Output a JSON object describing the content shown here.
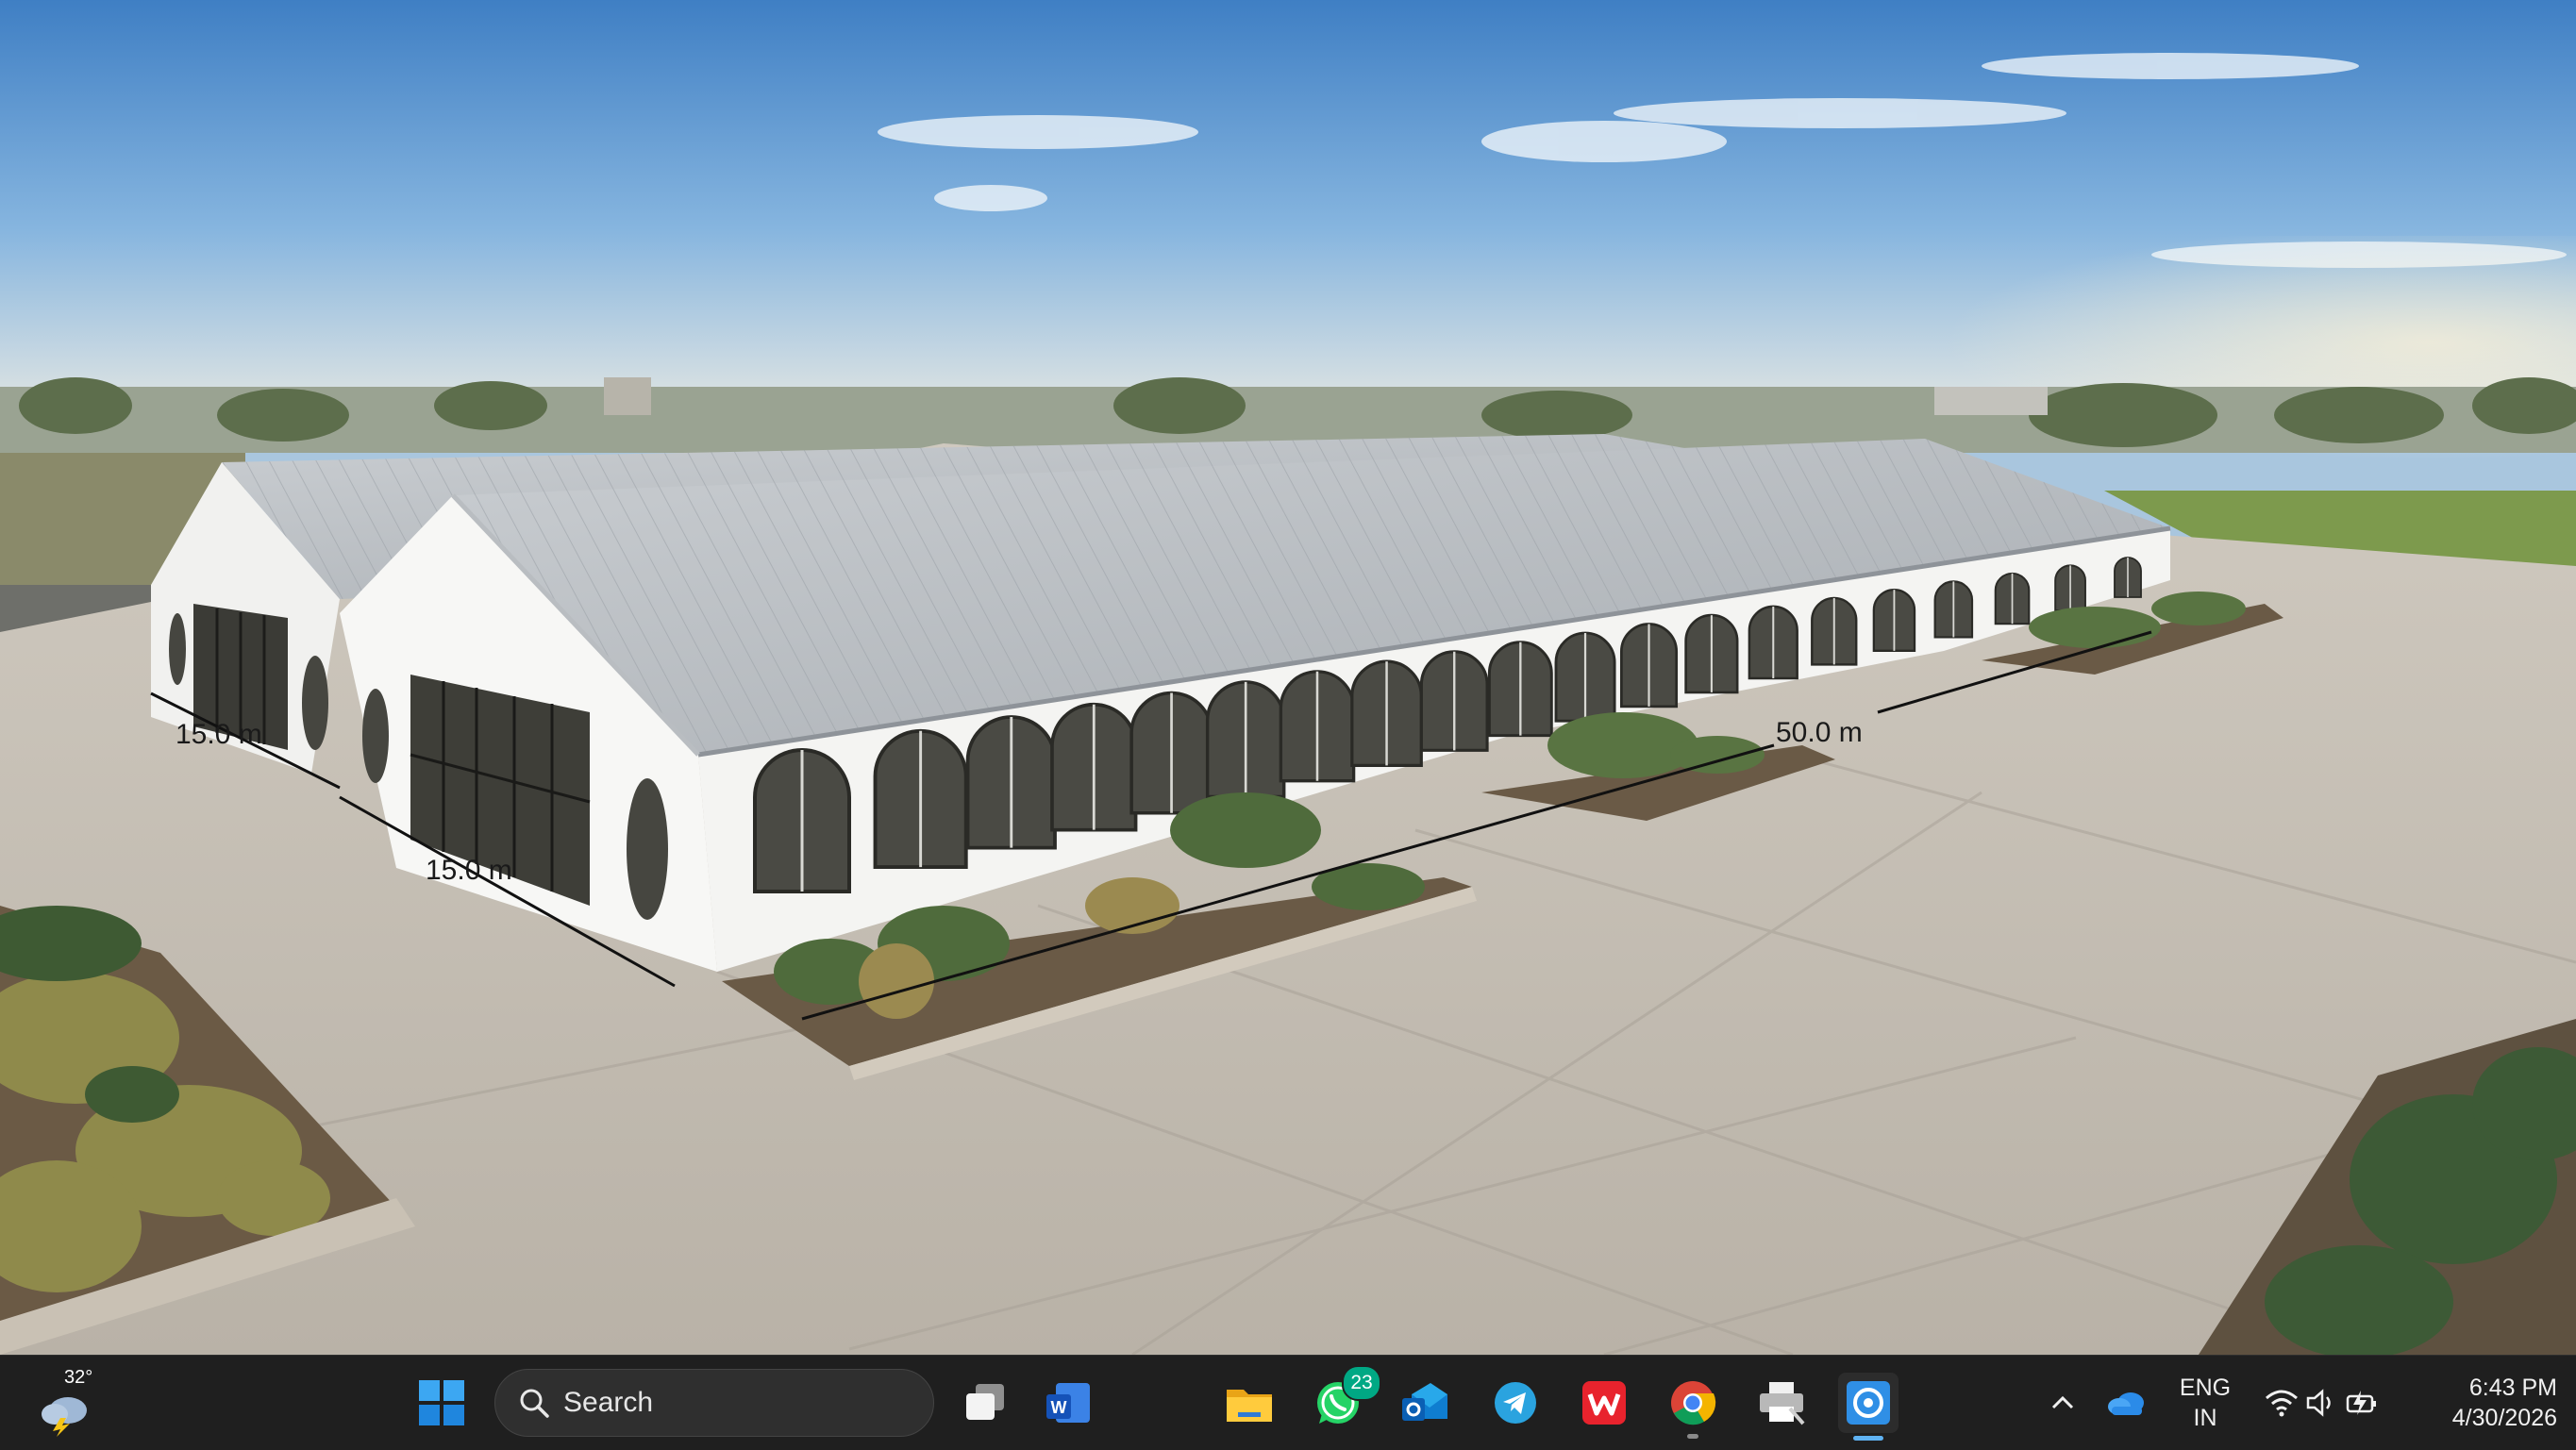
{
  "scene": {
    "measurements": {
      "front_gable_width": "15.0 m",
      "rear_gable_width": "15.0 m",
      "building_length": "50.0 m"
    }
  },
  "taskbar": {
    "weather": {
      "temperature": "32°",
      "icon": "thunderstorm-cloud-icon"
    },
    "start_icon": "windows-logo-icon",
    "search": {
      "label": "Search",
      "icon": "search-icon"
    },
    "apps": [
      {
        "name": "task-view",
        "icon": "task-view-icon"
      },
      {
        "name": "word",
        "icon": "word-icon"
      },
      {
        "name": "file-explorer",
        "icon": "folder-icon"
      },
      {
        "name": "whatsapp",
        "icon": "whatsapp-icon",
        "badge": "23"
      },
      {
        "name": "outlook",
        "icon": "outlook-icon"
      },
      {
        "name": "telegram",
        "icon": "telegram-icon"
      },
      {
        "name": "wps-office",
        "icon": "wps-icon"
      },
      {
        "name": "chrome",
        "icon": "chrome-icon"
      },
      {
        "name": "printer",
        "icon": "printer-icon"
      },
      {
        "name": "active-app",
        "icon": "app-icon"
      }
    ],
    "tray": {
      "language": "ENG",
      "region": "IN",
      "time": "6:43 PM",
      "date": "4/30/2026"
    },
    "colors": {
      "taskbar_bg": "#1f1f1f",
      "accent": "#5fb2f2"
    }
  }
}
